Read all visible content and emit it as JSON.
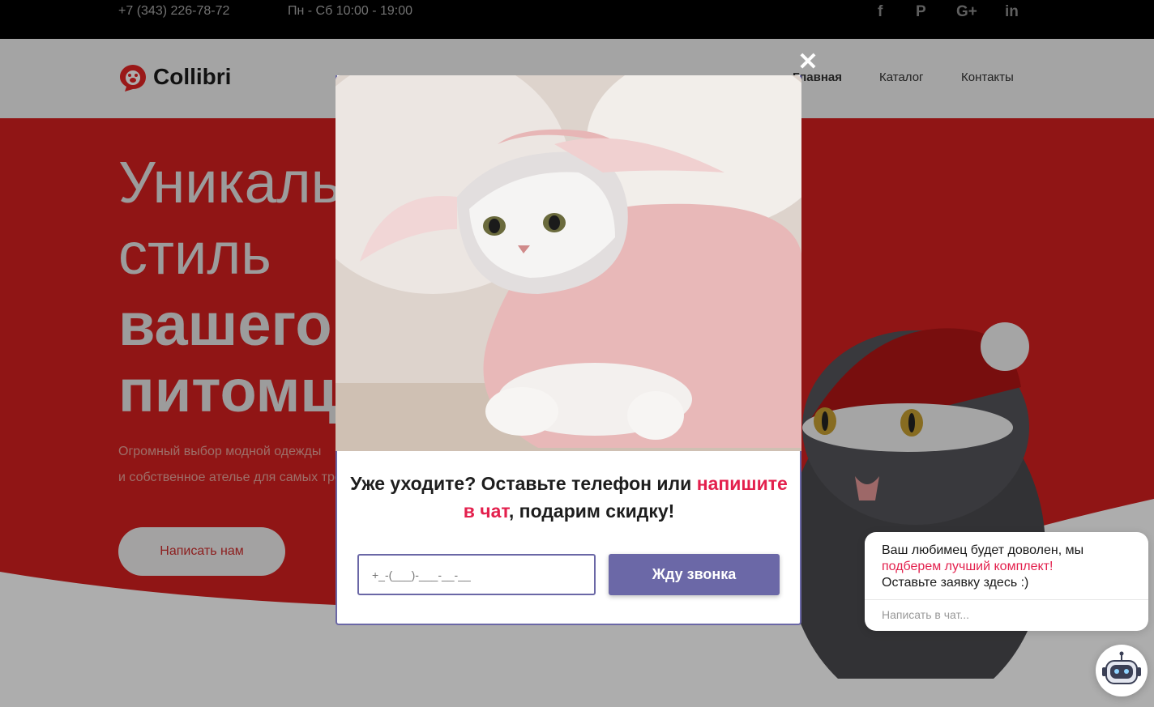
{
  "topbar": {
    "phone": "+7 (343) 226-78-72",
    "hours": "Пн - Сб 10:00 - 19:00",
    "social": [
      "f",
      "P",
      "G+",
      "in"
    ]
  },
  "header": {
    "brand": "Collibri",
    "nav": [
      "Главная",
      "Каталог",
      "Контакты"
    ]
  },
  "hero": {
    "line1": "Уникальный",
    "line2": "стиль",
    "line3": "вашего",
    "line4": "питомца",
    "sub1": "Огромный выбор модной одежды",
    "sub2": "и собственное ателье для самых требовательных",
    "button": "Написать нам"
  },
  "modal": {
    "close": "✕",
    "title_part1": "Уже уходите? Оставьте телефон или ",
    "title_accent": "напишите в чат",
    "title_part2": ", подарим скидку!",
    "phone_placeholder": "+_-(___)-___-__-__",
    "submit": "Жду звонка"
  },
  "chat": {
    "line1": "Ваш любимец будет доволен, мы",
    "line2": "подберем лучший комплект!",
    "line3": "Оставьте заявку здесь :)",
    "input_placeholder": "Написать в чат..."
  },
  "colors": {
    "accent": "#e3204d",
    "button": "#6b68a7",
    "hero_red": "#d41f1f"
  }
}
